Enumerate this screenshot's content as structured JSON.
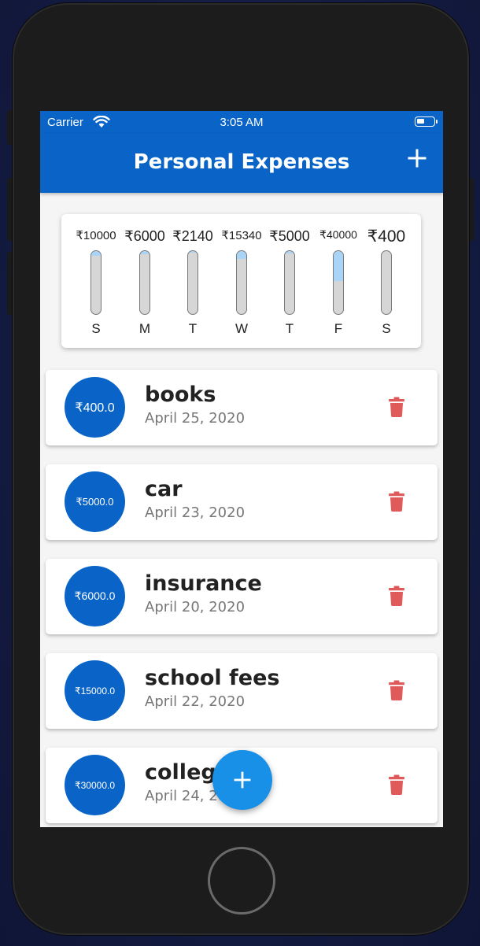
{
  "status_bar": {
    "carrier": "Carrier",
    "time": "3:05 AM"
  },
  "app_bar": {
    "title": "Personal Expenses",
    "add_icon": "plus-icon"
  },
  "chart": {
    "bars": [
      {
        "day": "S",
        "amount": "₹10000",
        "fill_fraction": 0.08
      },
      {
        "day": "M",
        "amount": "₹6000",
        "fill_fraction": 0.05
      },
      {
        "day": "T",
        "amount": "₹2140",
        "fill_fraction": 0.02
      },
      {
        "day": "W",
        "amount": "₹15340",
        "fill_fraction": 0.12
      },
      {
        "day": "T",
        "amount": "₹5000",
        "fill_fraction": 0.04
      },
      {
        "day": "F",
        "amount": "₹40000",
        "fill_fraction": 0.48
      },
      {
        "day": "S",
        "amount": "₹400",
        "fill_fraction": 0.0
      }
    ]
  },
  "transactions": [
    {
      "amount": "₹400.0",
      "title": "books",
      "date": "April 25, 2020"
    },
    {
      "amount": "₹5000.0",
      "title": "car",
      "date": "April 23, 2020"
    },
    {
      "amount": "₹6000.0",
      "title": "insurance",
      "date": "April 20, 2020"
    },
    {
      "amount": "₹15000.0",
      "title": "school fees",
      "date": "April 22, 2020"
    },
    {
      "amount": "₹30000.0",
      "title": "college",
      "date": "April 24, 2020"
    }
  ],
  "fab": {
    "icon": "plus-icon"
  },
  "colors": {
    "primary": "#0a64c8",
    "fab": "#1890e8",
    "bar_fill": "#a8d4f7",
    "delete": "#e05a5a"
  }
}
